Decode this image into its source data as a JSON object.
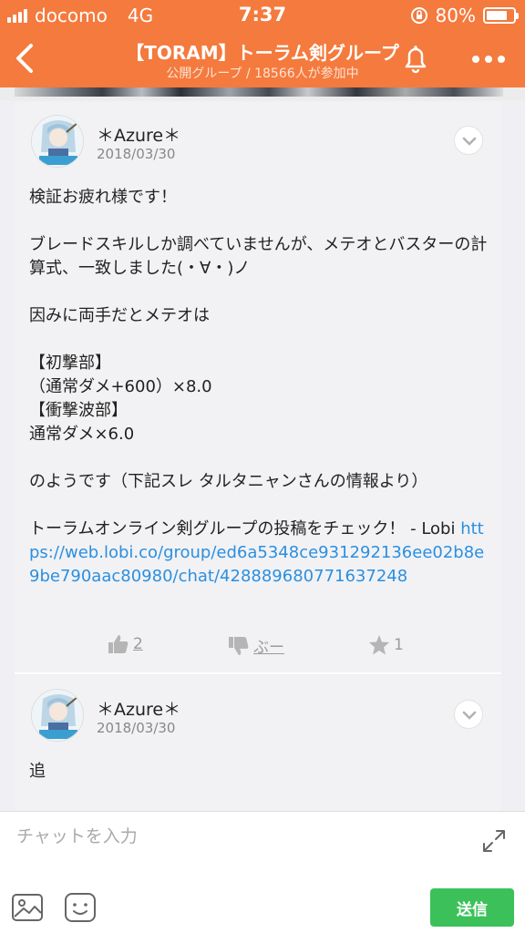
{
  "status": {
    "carrier": "docomo",
    "network": "4G",
    "time": "7:37",
    "battery": "80%",
    "battery_level": 0.8
  },
  "nav": {
    "title": "【TORAM】トーラム剣グループ",
    "subtitle": "公開グループ / 18566人が参加中"
  },
  "posts": [
    {
      "username": "＊Azure＊",
      "date": "2018/03/30",
      "body": "検証お疲れ様です！\n\nブレードスキルしか調べていませんが、メテオとバスターの計算式、一致しました(・∀・)ノ\n\n因みに両手だとメテオは\n\n【初撃部】\n（通常ダメ+600）×8.0\n【衝撃波部】\n通常ダメ×6.0\n\nのようです（下記スレ タルタニャンさんの情報より）\n\nトーラムオンライン剣グループの投稿をチェック！ - Lobi ",
      "link": "https://web.lobi.co/group/ed6a5348ce931292136ee02b8e9be790aac80980/chat/428889680771637248",
      "likes": "2",
      "boo": "ぶー",
      "stars": "1"
    },
    {
      "username": "＊Azure＊",
      "date": "2018/03/30",
      "body": "追"
    }
  ],
  "input": {
    "placeholder": "チャットを入力",
    "send_label": "送信"
  },
  "colors": {
    "brand": "#f47a3e",
    "link": "#2b8fe0",
    "send": "#3cc15a"
  }
}
